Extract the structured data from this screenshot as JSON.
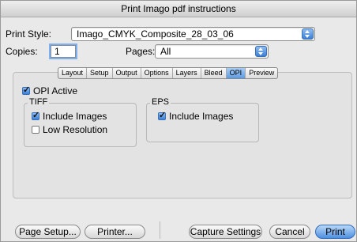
{
  "window": {
    "title": "Print Imago pdf instructions"
  },
  "print_style": {
    "label": "Print Style:",
    "value": "Imago_CMYK_Composite_28_03_06"
  },
  "copies": {
    "label": "Copies:",
    "value": "1"
  },
  "pages": {
    "label": "Pages:",
    "value": "All"
  },
  "tabs": [
    {
      "label": "Layout"
    },
    {
      "label": "Setup"
    },
    {
      "label": "Output"
    },
    {
      "label": "Options"
    },
    {
      "label": "Layers"
    },
    {
      "label": "Bleed"
    },
    {
      "label": "OPI"
    },
    {
      "label": "Preview"
    }
  ],
  "selected_tab": "OPI",
  "opi": {
    "active": {
      "label": "OPI Active",
      "checked": true
    },
    "tiff": {
      "label": "TIFF",
      "include_images": {
        "label": "Include Images",
        "checked": true
      },
      "low_resolution": {
        "label": "Low Resolution",
        "checked": false
      }
    },
    "eps": {
      "label": "EPS",
      "include_images": {
        "label": "Include Images",
        "checked": true
      }
    }
  },
  "buttons": {
    "page_setup": "Page Setup...",
    "printer": "Printer...",
    "capture_settings": "Capture Settings",
    "cancel": "Cancel",
    "print": "Print"
  },
  "colors": {
    "accent_blue": "#4e90e0"
  }
}
